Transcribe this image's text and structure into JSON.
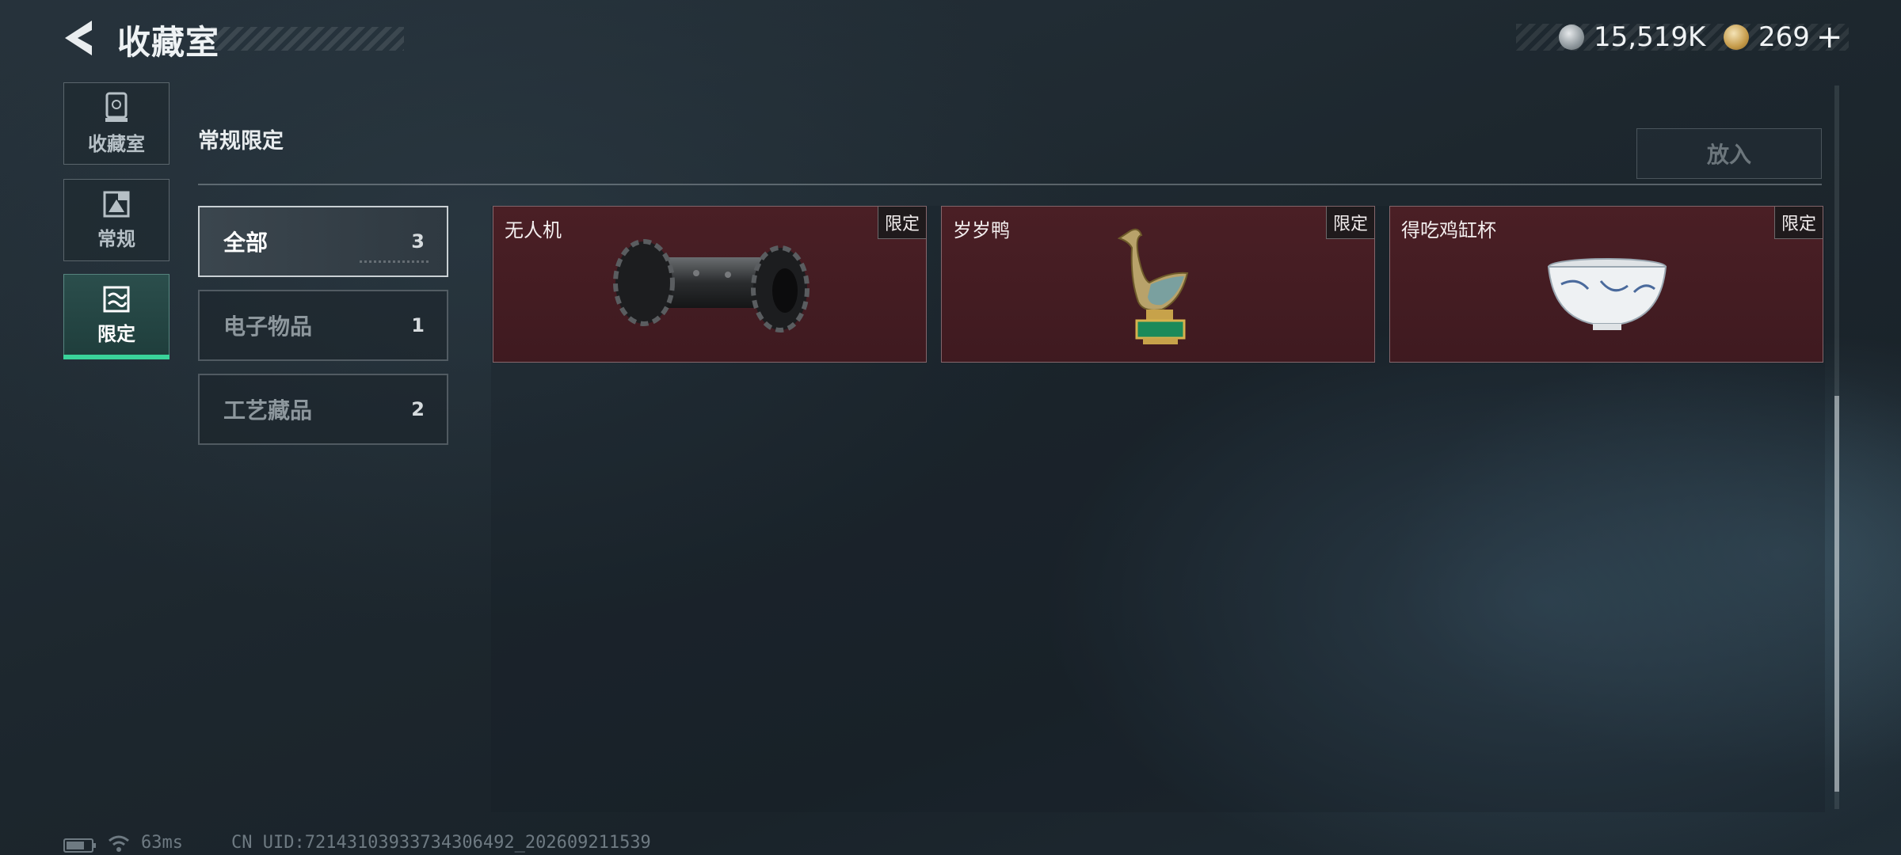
{
  "header": {
    "title": "收藏室"
  },
  "currency": {
    "silver": "15,519K",
    "gold": "269",
    "plus": "+"
  },
  "sidebar": {
    "items": [
      {
        "label": "收藏室",
        "icon": "trophy-case-icon"
      },
      {
        "label": "常规",
        "icon": "picture-frame-icon"
      },
      {
        "label": "限定",
        "icon": "limited-frame-icon",
        "active": true
      }
    ]
  },
  "section": {
    "title": "常规限定",
    "put_label": "放入"
  },
  "filters": [
    {
      "label": "全部",
      "count": "3",
      "active": true
    },
    {
      "label": "电子物品",
      "count": "1"
    },
    {
      "label": "工艺藏品",
      "count": "2"
    }
  ],
  "items": [
    {
      "name": "无人机",
      "tag": "限定",
      "icon": "drone-icon"
    },
    {
      "name": "岁岁鸭",
      "tag": "限定",
      "icon": "duck-statue-icon"
    },
    {
      "name": "得吃鸡缸杯",
      "tag": "限定",
      "icon": "porcelain-cup-icon"
    }
  ],
  "status": {
    "ping": "63ms",
    "uid": "CN UID:72143103933734306492_202609211539"
  },
  "colors": {
    "accent": "#3ad39a",
    "card_bg": "#4a1f25",
    "background": "#1d272e"
  }
}
